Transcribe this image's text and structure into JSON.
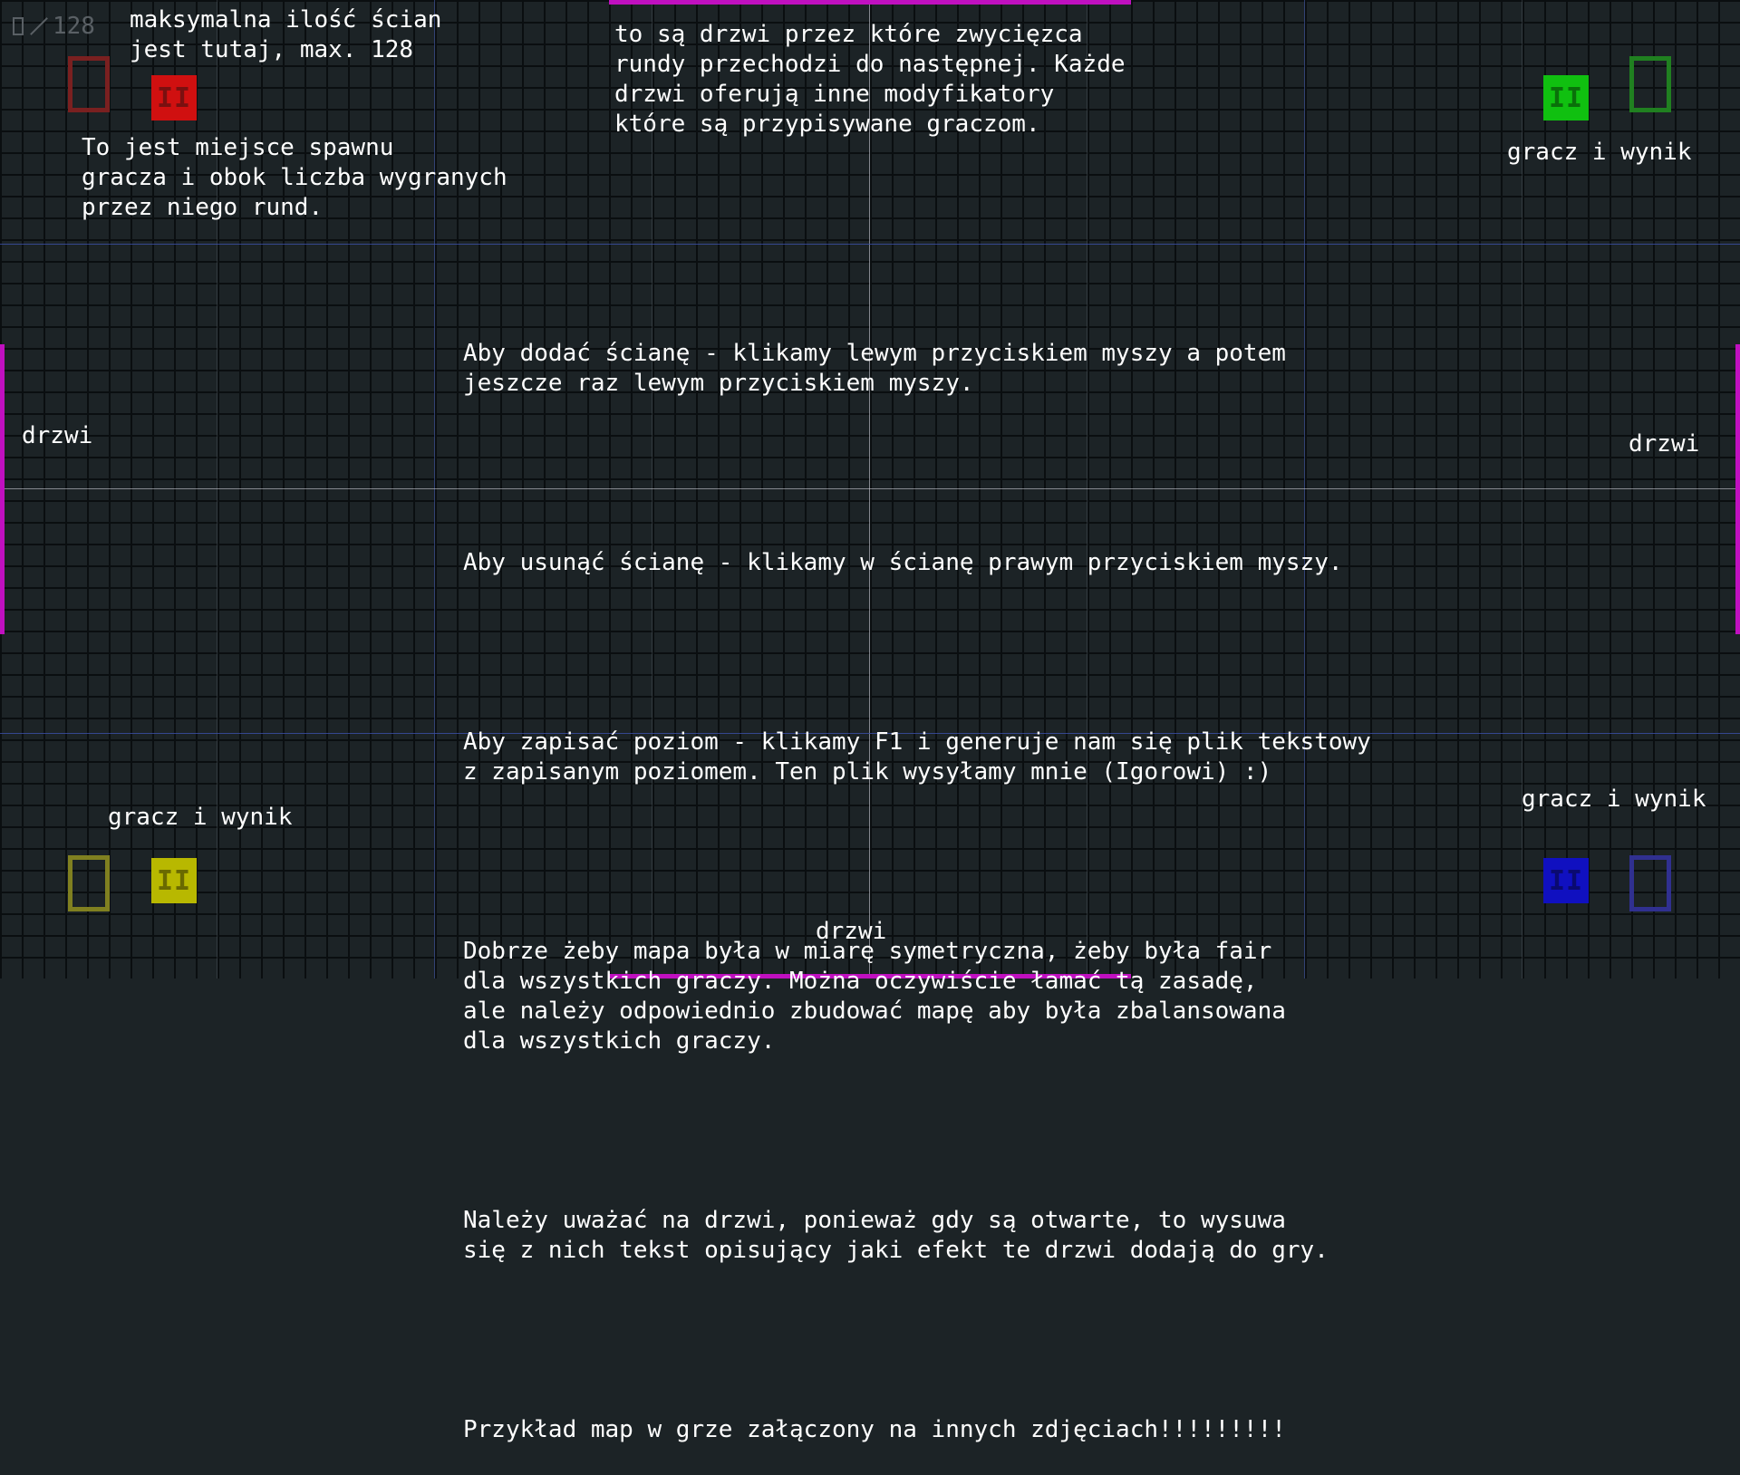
{
  "hud": {
    "slash": "/",
    "max_walls": "128"
  },
  "colors": {
    "background": "#1c2326",
    "door": "#c010c0",
    "player_red": "#d01010",
    "player_red_outline": "#7a2020",
    "player_green": "#10c010",
    "player_green_outline": "#208020",
    "player_yellow": "#b8b800",
    "player_yellow_outline": "#808020",
    "player_blue": "#1010c0",
    "player_blue_outline": "#303090"
  },
  "players": {
    "red": {
      "score": "II"
    },
    "green": {
      "score": "II"
    },
    "yellow": {
      "score": "II"
    },
    "blue": {
      "score": "II"
    }
  },
  "notes": {
    "max_walls": [
      "maksymalna ilość ścian",
      "jest tutaj, max. 128"
    ],
    "spawn": [
      "To jest miejsce spawnu",
      "gracza i obok liczba wygranych",
      "przez niego rund."
    ],
    "top_door": [
      "to są drzwi przez które zwycięzca",
      "rundy przechodzi do następnej. Każde",
      "drzwi oferują inne modyfikatory",
      "które są przypisywane graczom."
    ],
    "player_score_top_right": "gracz i wynik",
    "player_score_bottom_left": "gracz i wynik",
    "player_score_bottom_right": "gracz i wynik",
    "door_left": "drzwi",
    "door_right": "drzwi",
    "door_bottom": "drzwi"
  },
  "instructions": {
    "add_wall": [
      "Aby dodać ścianę - klikamy lewym przyciskiem myszy a potem",
      "jeszcze raz lewym przyciskiem myszy."
    ],
    "remove_wall": [
      "Aby usunąć ścianę - klikamy w ścianę prawym przyciskiem myszy."
    ],
    "save_level": [
      "Aby zapisać poziom - klikamy F1 i generuje nam się plik tekstowy",
      "z zapisanym poziomem. Ten plik wysyłamy mnie (Igorowi) :)"
    ],
    "symmetry": [
      "Dobrze żeby mapa była w miarę symetryczna, żeby była fair",
      "dla wszystkich graczy. Można oczywiście łamać tą zasadę,",
      "ale należy odpowiednio zbudować mapę aby była zbalansowana",
      "dla wszystkich graczy."
    ],
    "doors": [
      "Należy uważać na drzwi, ponieważ gdy są otwarte, to wysuwa",
      "się z nich tekst opisujący jaki efekt te drzwi dodają do gry."
    ],
    "examples": [
      "Przykład map w grze załączony na innych zdjęciach!!!!!!!!!"
    ]
  }
}
